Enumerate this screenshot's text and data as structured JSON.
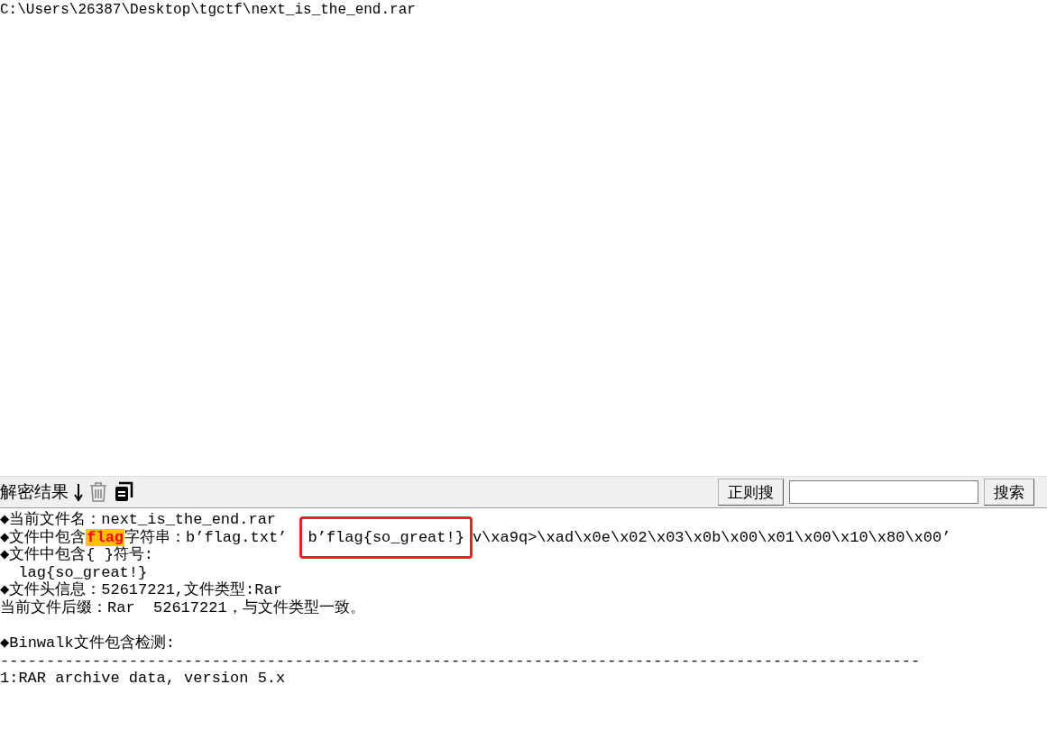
{
  "path": "C:\\Users\\26387\\Desktop\\tgctf\\next_is_the_end.rar",
  "toolbar": {
    "title": "解密结果",
    "regex_button": "正则搜",
    "search_button": "搜索"
  },
  "output": [
    {
      "kind": "plain",
      "text": "◆当前文件名：next_is_the_end.rar"
    },
    {
      "kind": "highlight",
      "before": "◆文件中包含",
      "mark": "flag",
      "after": "字符串：b’flag.txt’ ",
      "boxed": "b’flag{so_great!}",
      "rest": "v\\xa9q>\\xad\\x0e\\x02\\x03\\x0b\\x00\\x01\\x00\\x10\\x80\\x00’"
    },
    {
      "kind": "plain",
      "text": "◆文件中包含{ }符号:"
    },
    {
      "kind": "plain",
      "text": "  lag{so_great!}"
    },
    {
      "kind": "plain",
      "text": "◆文件头信息：52617221,文件类型:Rar"
    },
    {
      "kind": "plain",
      "text": "当前文件后缀：Rar  52617221，与文件类型一致。"
    },
    {
      "kind": "blank"
    },
    {
      "kind": "plain",
      "text": "◆Binwalk文件包含检测:"
    },
    {
      "kind": "plain",
      "text": "----------------------------------------------------------------------------------------------------"
    },
    {
      "kind": "plain",
      "text": "1:RAR archive data, version 5.x"
    }
  ]
}
